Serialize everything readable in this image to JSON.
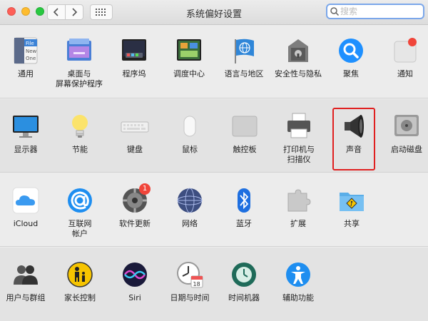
{
  "window": {
    "title": "系统偏好设置"
  },
  "search": {
    "placeholder": "搜索"
  },
  "colors": {
    "highlight": "#e02020",
    "accent": "#1e90ff"
  },
  "sections": [
    {
      "items": [
        {
          "label": "通用",
          "icon": "general-icon"
        },
        {
          "label": "桌面与\n屏幕保护程序",
          "icon": "desktop-screensaver-icon"
        },
        {
          "label": "程序坞",
          "icon": "dock-icon"
        },
        {
          "label": "调度中心",
          "icon": "mission-control-icon"
        },
        {
          "label": "语言与地区",
          "icon": "language-region-icon"
        },
        {
          "label": "安全性与隐私",
          "icon": "security-privacy-icon"
        },
        {
          "label": "聚焦",
          "icon": "spotlight-icon"
        },
        {
          "label": "通知",
          "icon": "notifications-icon"
        }
      ]
    },
    {
      "items": [
        {
          "label": "显示器",
          "icon": "displays-icon"
        },
        {
          "label": "节能",
          "icon": "energy-saver-icon"
        },
        {
          "label": "键盘",
          "icon": "keyboard-icon"
        },
        {
          "label": "鼠标",
          "icon": "mouse-icon"
        },
        {
          "label": "触控板",
          "icon": "trackpad-icon"
        },
        {
          "label": "打印机与\n扫描仪",
          "icon": "printers-scanners-icon"
        },
        {
          "label": "声音",
          "icon": "sound-icon"
        },
        {
          "label": "启动磁盘",
          "icon": "startup-disk-icon"
        }
      ]
    },
    {
      "items": [
        {
          "label": "iCloud",
          "icon": "icloud-icon"
        },
        {
          "label": "互联网\n帐户",
          "icon": "internet-accounts-icon"
        },
        {
          "label": "软件更新",
          "icon": "software-update-icon",
          "badge": "1"
        },
        {
          "label": "网络",
          "icon": "network-icon"
        },
        {
          "label": "蓝牙",
          "icon": "bluetooth-icon"
        },
        {
          "label": "扩展",
          "icon": "extensions-icon"
        },
        {
          "label": "共享",
          "icon": "sharing-icon"
        }
      ]
    },
    {
      "items": [
        {
          "label": "用户与群组",
          "icon": "users-groups-icon"
        },
        {
          "label": "家长控制",
          "icon": "parental-controls-icon"
        },
        {
          "label": "Siri",
          "icon": "siri-icon"
        },
        {
          "label": "日期与时间",
          "icon": "date-time-icon"
        },
        {
          "label": "时间机器",
          "icon": "time-machine-icon"
        },
        {
          "label": "辅助功能",
          "icon": "accessibility-icon"
        }
      ]
    }
  ],
  "icon_text": {
    "general_lines": [
      "File",
      "New",
      "One"
    ],
    "calendar_day": "18"
  }
}
